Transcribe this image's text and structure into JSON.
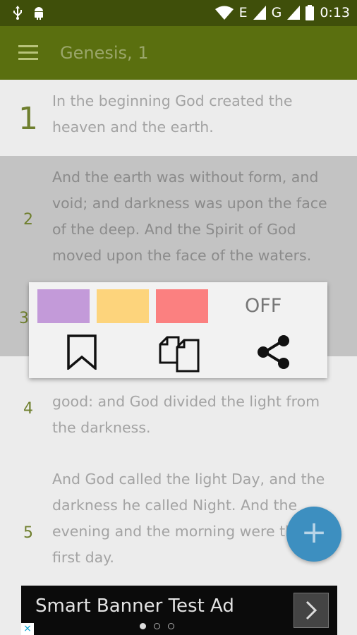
{
  "status_bar": {
    "network_label": "E",
    "network_label_2": "G",
    "time": "0:13"
  },
  "app_bar": {
    "title": "Genesis, 1"
  },
  "verses": [
    {
      "number": "1",
      "text": "In the beginning God created the heaven and the earth."
    },
    {
      "number": "2",
      "text": "And the earth was without form, and void; and darkness was upon the face of the deep. And the Spirit of God moved upon the face of the waters."
    },
    {
      "number": "3",
      "text": ""
    },
    {
      "number": "4",
      "text": "good: and God divided the light from the darkness."
    },
    {
      "number": "5",
      "text": "And God called the light Day, and the darkness he called Night. And the evening and the morning were the first day."
    }
  ],
  "popup": {
    "highlight_colors": [
      "#c39ad9",
      "#fdd47c",
      "#fb8080"
    ],
    "off_label": "OFF"
  },
  "fab": {
    "label": "+"
  },
  "ad": {
    "text": "Smart Banner Test Ad",
    "close_glyph": "×"
  }
}
